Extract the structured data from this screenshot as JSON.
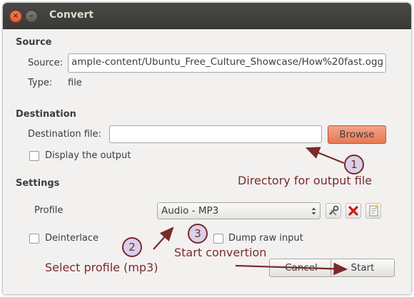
{
  "window": {
    "title": "Convert",
    "close_icon": "×",
    "min_icon": "–"
  },
  "source": {
    "section": "Source",
    "source_label": "Source:",
    "source_value": "ample-content/Ubuntu_Free_Culture_Showcase/How%20fast.ogg",
    "type_label": "Type:",
    "type_value": "file"
  },
  "destination": {
    "section": "Destination",
    "file_label": "Destination file:",
    "file_value": "",
    "browse_label": "Browse",
    "display_output_label": "Display the output",
    "display_output_checked": false
  },
  "settings": {
    "section": "Settings",
    "profile_label": "Profile",
    "profile_value": "Audio - MP3",
    "deinterlace_label": "Deinterlace",
    "deinterlace_checked": false,
    "dump_raw_label": "Dump raw input",
    "dump_raw_checked": false
  },
  "buttons": {
    "cancel_label": "Cancel",
    "start_label": "Start"
  },
  "annotations": {
    "n1": "1",
    "n2": "2",
    "n3": "3",
    "t1": "Directory for output file",
    "t2": "Select profile (mp3)",
    "t3": "Start convertion"
  },
  "colors": {
    "annotation": "#7a2a2a",
    "browse": "#e67953",
    "circle_fill": "#d9d0ea"
  },
  "icons": [
    "edit-profile-icon",
    "delete-profile-icon",
    "new-profile-icon",
    "combo-spinner-icon"
  ]
}
